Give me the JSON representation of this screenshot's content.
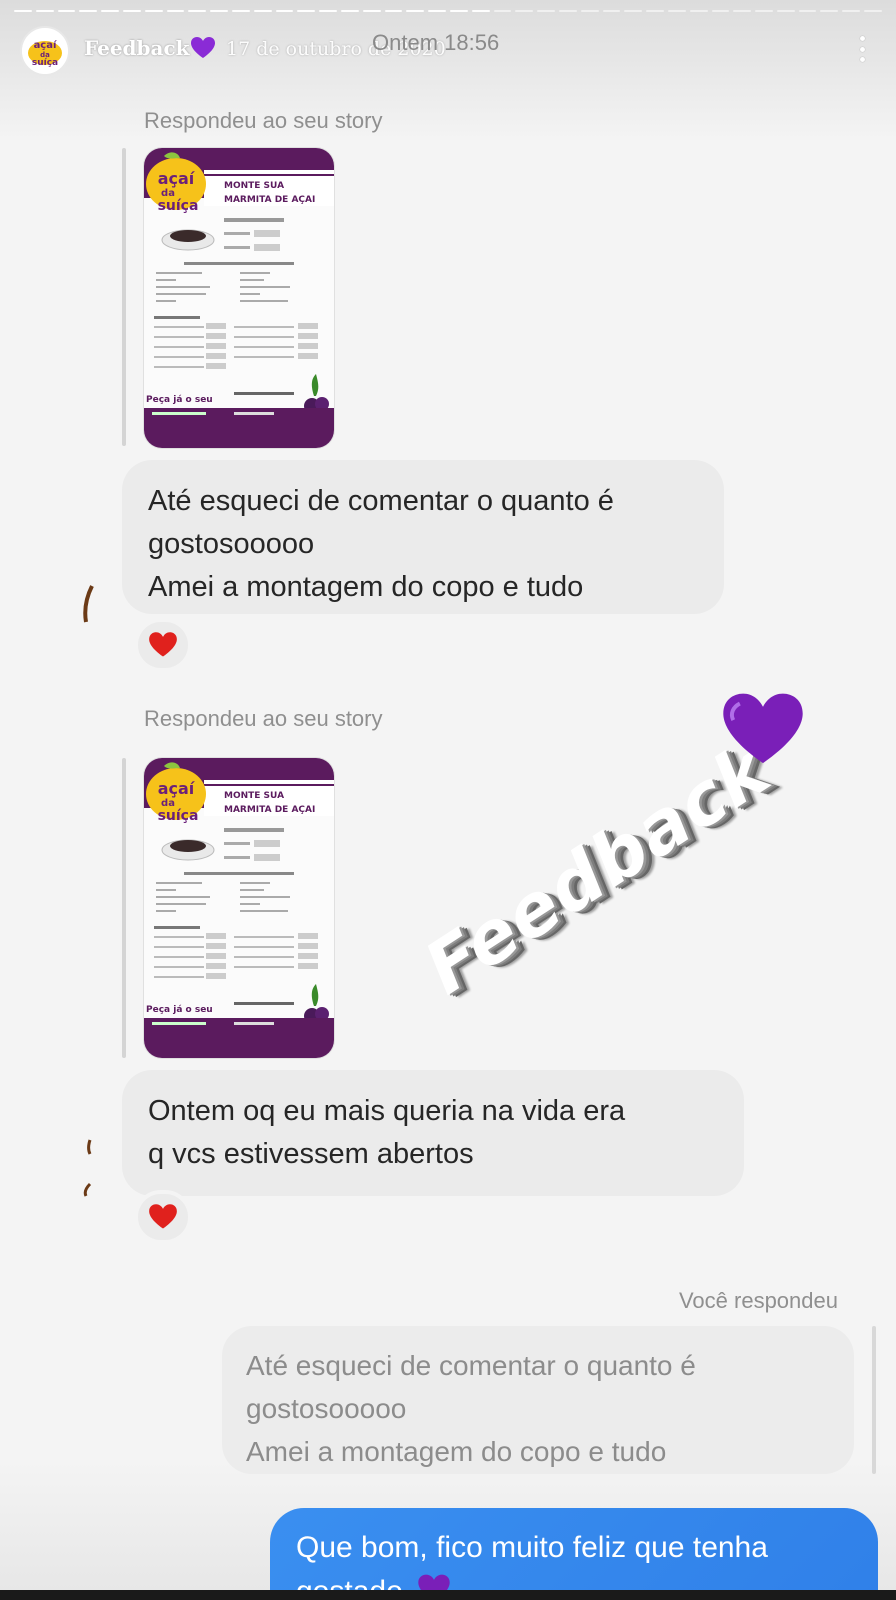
{
  "header": {
    "username": "Feedback",
    "heart_icon": "purple-heart-icon",
    "date": "17 de outubro de 2020",
    "time_label": "Ontem 18:56",
    "more_icon": "more-vertical-icon"
  },
  "thread": [
    {
      "reply_label": "Respondeu ao seu story",
      "story_thumb": {
        "title_line1": "MONTE SUA",
        "title_line2": "MARMITA DE AÇAI",
        "logo_line1": "açaí",
        "logo_line2": "da",
        "logo_line3": "suíça",
        "footer": "Peça já o seu"
      },
      "message_lines": [
        "Até esqueci de comentar o quanto é",
        "gostosooooo",
        "Amei a montagem do copo e tudo"
      ],
      "reaction": "red-heart-icon"
    },
    {
      "reply_label": "Respondeu ao seu story",
      "story_thumb": {
        "title_line1": "MONTE SUA",
        "title_line2": "MARMITA DE AÇAI",
        "logo_line1": "açaí",
        "logo_line2": "da",
        "logo_line3": "suíça",
        "footer": "Peça já o seu"
      },
      "message_lines": [
        "Ontem oq eu mais queria na vida era",
        "q vcs estivessem abertos"
      ],
      "reaction": "red-heart-icon"
    }
  ],
  "you_replied": {
    "label": "Você respondeu",
    "quoted_lines": [
      "Até esqueci de comentar o quanto é",
      "gostosooooo",
      "Amei a montagem do copo e tudo"
    ],
    "reply_lines": [
      "Que bom, fico muito feliz que tenha",
      "gostado"
    ]
  },
  "sticker": {
    "text": "Feedback",
    "heart_icon": "purple-heart-icon"
  },
  "colors": {
    "purple": "#7a1fb8",
    "menu_purple": "#5b1b5e",
    "heart_red": "#e0211d",
    "sent_blue": "#3797f0"
  }
}
